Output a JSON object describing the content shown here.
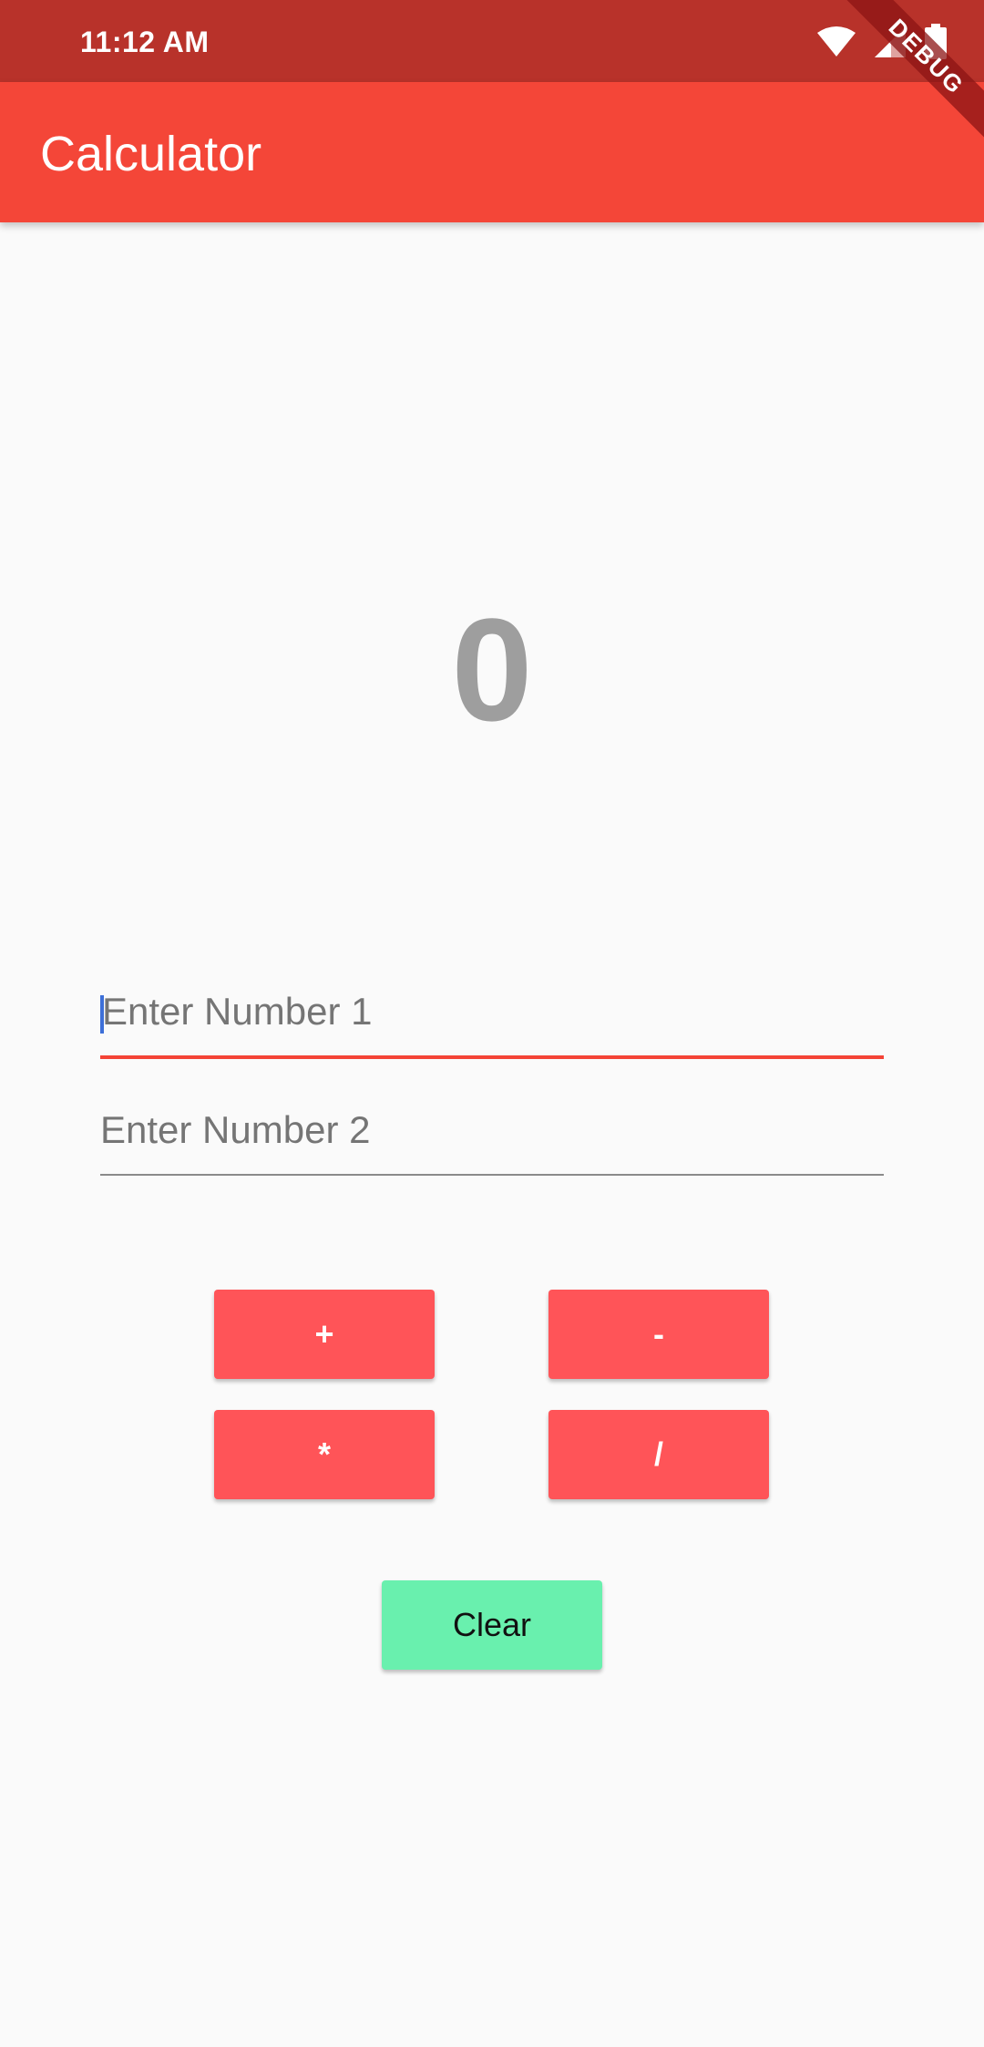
{
  "status_bar": {
    "time": "11:12 AM",
    "icons": [
      "wifi-icon",
      "cellular-signal-icon",
      "battery-icon"
    ]
  },
  "app_bar": {
    "title": "Calculator"
  },
  "debug_banner": {
    "label": "DEBUG"
  },
  "result": {
    "value": "0"
  },
  "inputs": {
    "number1": {
      "value": "",
      "placeholder": "Enter Number 1"
    },
    "number2": {
      "value": "",
      "placeholder": "Enter Number 2"
    }
  },
  "buttons": {
    "add": "+",
    "subtract": "-",
    "multiply": "*",
    "divide": "/",
    "clear": "Clear"
  },
  "colors": {
    "status_bar": "#b8322a",
    "app_bar": "#f44638",
    "operator_button": "#ff5458",
    "clear_button": "#69f0ae",
    "focused_underline": "#f44336",
    "result_text": "#9e9e9e"
  }
}
